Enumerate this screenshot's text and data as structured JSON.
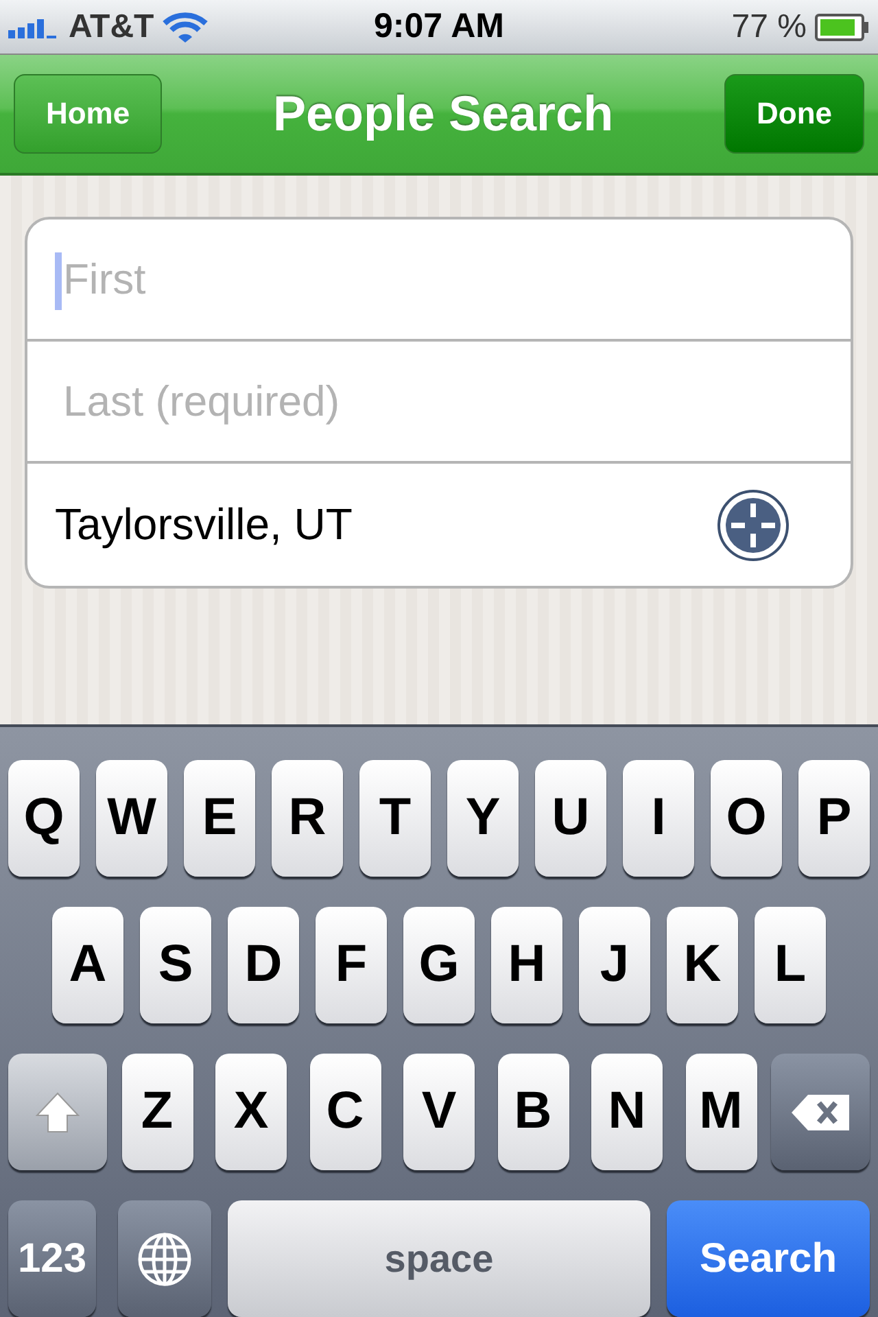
{
  "status_bar": {
    "carrier": "AT&T",
    "time": "9:07 AM",
    "battery": "77 %"
  },
  "nav_bar": {
    "left_button": "Home",
    "title": "People Search",
    "right_button": "Done"
  },
  "form": {
    "fields": [
      {
        "kind": "text",
        "placeholder": "First",
        "focused": true
      },
      {
        "kind": "text",
        "placeholder": "Last (required)",
        "focused": false
      },
      {
        "kind": "location",
        "value": "Taylorsville, UT"
      }
    ]
  },
  "keyboard": {
    "key_rows": [
      {
        "keys": [
          {
            "kind": "letter",
            "label": "Q"
          },
          {
            "kind": "letter",
            "label": "W"
          },
          {
            "kind": "letter",
            "label": "E"
          },
          {
            "kind": "letter",
            "label": "R"
          },
          {
            "kind": "letter",
            "label": "T"
          },
          {
            "kind": "letter",
            "label": "Y"
          },
          {
            "kind": "letter",
            "label": "U"
          },
          {
            "kind": "letter",
            "label": "I"
          },
          {
            "kind": "letter",
            "label": "O"
          },
          {
            "kind": "letter",
            "label": "P"
          }
        ]
      },
      {
        "keys": [
          {
            "kind": "letter",
            "label": "A"
          },
          {
            "kind": "letter",
            "label": "S"
          },
          {
            "kind": "letter",
            "label": "D"
          },
          {
            "kind": "letter",
            "label": "F"
          },
          {
            "kind": "letter",
            "label": "G"
          },
          {
            "kind": "letter",
            "label": "H"
          },
          {
            "kind": "letter",
            "label": "J"
          },
          {
            "kind": "letter",
            "label": "K"
          },
          {
            "kind": "letter",
            "label": "L"
          }
        ]
      },
      {
        "keys": [
          {
            "kind": "shift"
          },
          {
            "kind": "letter",
            "label": "Z"
          },
          {
            "kind": "letter",
            "label": "X"
          },
          {
            "kind": "letter",
            "label": "C"
          },
          {
            "kind": "letter",
            "label": "V"
          },
          {
            "kind": "letter",
            "label": "B"
          },
          {
            "kind": "letter",
            "label": "N"
          },
          {
            "kind": "letter",
            "label": "M"
          },
          {
            "kind": "backspace"
          }
        ]
      },
      {
        "keys": [
          {
            "kind": "mode",
            "label": "123"
          },
          {
            "kind": "globe"
          },
          {
            "kind": "space",
            "label": "space"
          },
          {
            "kind": "action",
            "label": "Search"
          }
        ]
      }
    ]
  }
}
